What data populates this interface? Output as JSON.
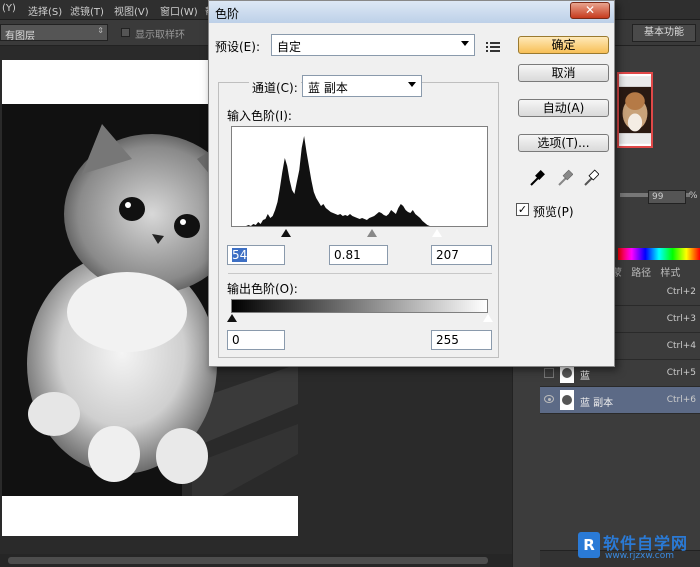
{
  "menubar": {
    "items": [
      "(Y)",
      "选择(S)",
      "滤镜(T)",
      "视图(V)",
      "窗口(W)",
      "帮"
    ]
  },
  "options": {
    "layer_select": "有图层",
    "sample_ring_label": "显示取样环",
    "workspace_label": "基本功能"
  },
  "dialog": {
    "title": "色阶",
    "close_label": "✕",
    "preset_label": "预设(E):",
    "preset_value": "自定",
    "channel_label": "通道(C):",
    "channel_value": "蓝 副本",
    "input_levels_label": "输入色阶(I):",
    "input_black": "54",
    "input_gamma": "0.81",
    "input_white": "207",
    "output_levels_label": "输出色阶(O):",
    "output_black": "0",
    "output_white": "255",
    "buttons": {
      "ok": "确定",
      "cancel": "取消",
      "auto": "自动(A)",
      "options": "选项(T)..."
    },
    "preview_label": "预览(P)",
    "preview_checked": true,
    "histogram": [
      0,
      1,
      1,
      2,
      1,
      2,
      3,
      2,
      4,
      3,
      6,
      4,
      8,
      9,
      14,
      10,
      12,
      18,
      26,
      40,
      56,
      70,
      62,
      48,
      38,
      34,
      46,
      58,
      80,
      92,
      76,
      62,
      48,
      36,
      30,
      26,
      22,
      24,
      20,
      18,
      16,
      15,
      14,
      13,
      14,
      12,
      13,
      12,
      14,
      12,
      11,
      10,
      9,
      10,
      9,
      8,
      10,
      11,
      12,
      14,
      16,
      15,
      13,
      12,
      14,
      18,
      16,
      14,
      20,
      24,
      22,
      18,
      16,
      15,
      18,
      14,
      12,
      10,
      7,
      5,
      3,
      2,
      1,
      1,
      0
    ]
  },
  "panels": {
    "opacity_value": "99",
    "opacity_unit": "%",
    "tabs": [
      "蒙",
      "路径",
      "样式"
    ],
    "channels": [
      {
        "name": "",
        "key": "Ctrl+2",
        "visible": false,
        "selected": false
      },
      {
        "name": "",
        "key": "Ctrl+3",
        "visible": false,
        "selected": false
      },
      {
        "name": "",
        "key": "Ctrl+4",
        "visible": false,
        "selected": false
      },
      {
        "name": "蓝",
        "key": "Ctrl+5",
        "visible": false,
        "selected": false
      },
      {
        "name": "蓝 副本",
        "key": "Ctrl+6",
        "visible": true,
        "selected": true
      }
    ]
  },
  "watermark": {
    "logo": "R",
    "title": "软件自学网",
    "url": "www.rjzxw.com"
  },
  "colors": {
    "selected_row": "#5c6a86",
    "ok_button": "#f7bf57",
    "watermark": "#2a7ad6"
  }
}
